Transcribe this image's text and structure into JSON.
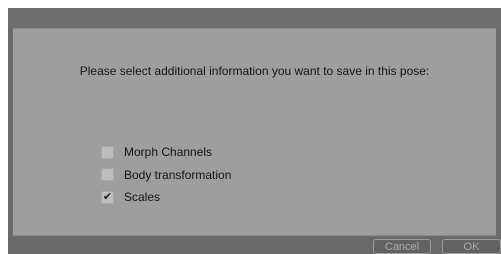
{
  "dialog": {
    "prompt": "Please select additional information you want to save in this pose:",
    "options": [
      {
        "label": "Morph Channels",
        "checked": false,
        "mark": ""
      },
      {
        "label": "Body transformation",
        "checked": false,
        "mark": ""
      },
      {
        "label": "Scales",
        "checked": true,
        "mark": "✔"
      }
    ],
    "buttons": {
      "cancel": "Cancel",
      "ok": "OK"
    }
  },
  "colors": {
    "dialog_frame": "#6c6c6c",
    "content_bg": "#9e9e9e",
    "checkbox_bg": "#bdbdbd",
    "button_text": "#adadad"
  }
}
